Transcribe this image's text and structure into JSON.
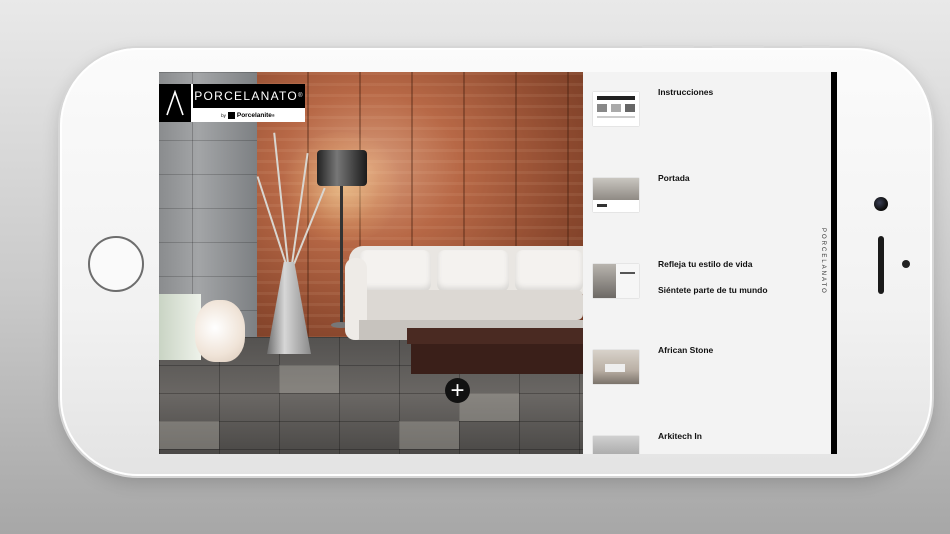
{
  "app": {
    "logo": {
      "brand": "PORCELANATO",
      "registered": "®",
      "sub_prefix": "by",
      "sub_brand": "Porcelanite",
      "sub_registered": "®"
    },
    "side_tab_label": "PORCELANATO"
  },
  "hero": {
    "add_button_label": "+"
  },
  "catalog": {
    "items": [
      {
        "title": "Instrucciones",
        "subtitle": ""
      },
      {
        "title": "Portada",
        "subtitle": ""
      },
      {
        "title": "Refleja tu estilo de vida",
        "subtitle": "Siéntete parte de tu mundo"
      },
      {
        "title": "African Stone",
        "subtitle": ""
      },
      {
        "title": "Arkitech In",
        "subtitle": ""
      }
    ]
  },
  "colors": {
    "accent": "#000000",
    "panel_bg": "#f3f3f3",
    "phone_body": "#f4f4f4"
  }
}
